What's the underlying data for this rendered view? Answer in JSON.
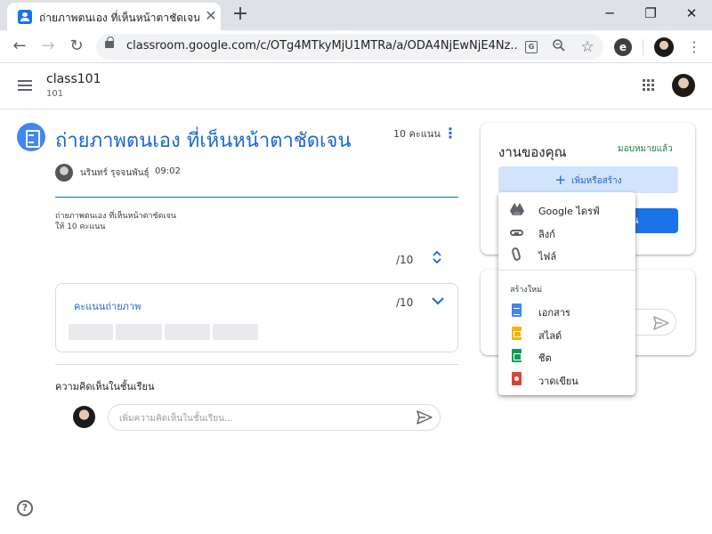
{
  "browser": {
    "tab_title": "ถ่ายภาพตนเอง ที่เห็นหน้าตาชัดเจน",
    "tab_close": "✕",
    "new_tab": "+",
    "url": "classroom.google.com/c/OTg4MTkyMjU1MTRa/a/ODA4NjEwNjE4Nz...",
    "window_controls": {
      "minimize": "─",
      "maximize": "❐",
      "close": "✕"
    },
    "nav": {
      "back": "←",
      "forward": "→",
      "reload": "↻"
    },
    "extension_letter": "e"
  },
  "class": {
    "name": "class101",
    "section": "101"
  },
  "assignment": {
    "title": "ถ่ายภาพตนเอง ที่เห็นหน้าตาชัดเจน",
    "points": "10 คะแนน",
    "author": "นรินทร์ รุจจนพันธุ์",
    "time": "09:02",
    "description_line1": "ถ่ายภาพตนเอง ที่เห็นหน้าตาชัดเจน",
    "description_line2": "ให้ 10 คะแนน",
    "total_score": "/10",
    "rubric": {
      "criterion": "คะแนนถ่ายภาพ",
      "score": "/10"
    }
  },
  "comments": {
    "heading": "ความคิดเห็นในชั้นเรียน",
    "placeholder": "เพิ่มความคิดเห็นในชั้นเรียน..."
  },
  "your_work": {
    "title": "งานของคุณ",
    "status": "มอบหมายแล้ว",
    "add_create_label": "เพิ่มหรือสร้าง",
    "add_icon": "+",
    "turn_in_partial": "น"
  },
  "dropdown": {
    "attach_items": [
      {
        "label": "Google ไดรฟ์",
        "icon": "google-drive-icon"
      },
      {
        "label": "ลิงก์",
        "icon": "link-icon"
      },
      {
        "label": "ไฟล์",
        "icon": "paperclip-icon"
      }
    ],
    "create_heading": "สร้างใหม่",
    "create_items": [
      {
        "label": "เอกสาร",
        "icon": "docs-icon",
        "color": "#4285f4"
      },
      {
        "label": "สไลด์",
        "icon": "slides-icon",
        "color": "#f4b400"
      },
      {
        "label": "ชีต",
        "icon": "sheets-icon",
        "color": "#0f9d58"
      },
      {
        "label": "วาดเขียน",
        "icon": "drawings-icon",
        "color": "#db4437"
      }
    ]
  },
  "colors": {
    "primary_blue": "#1967d2",
    "button_blue": "#1a73e8",
    "light_blue": "#d2e3fc",
    "assigned_green": "#188038"
  },
  "help_glyph": "?"
}
